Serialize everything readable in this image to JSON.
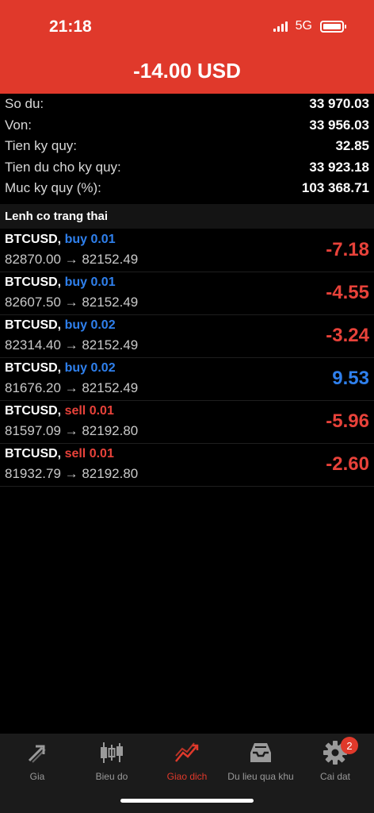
{
  "status": {
    "time": "21:18",
    "network": "5G"
  },
  "header": {
    "title": "-14.00 USD"
  },
  "summary": [
    {
      "label": "So du:",
      "value": "33 970.03"
    },
    {
      "label": "Von:",
      "value": "33 956.03"
    },
    {
      "label": "Tien ky quy:",
      "value": "32.85"
    },
    {
      "label": "Tien du cho ky quy:",
      "value": "33 923.18"
    },
    {
      "label": "Muc ky quy (%):",
      "value": "103 368.71"
    }
  ],
  "section": {
    "title": "Lenh co trang thai"
  },
  "orders": [
    {
      "symbol": "BTCUSD,",
      "side": "buy 0.01",
      "prices": "82870.00 → 82152.49",
      "profit": "-7.18"
    },
    {
      "symbol": "BTCUSD,",
      "side": "buy 0.01",
      "prices": "82607.50 → 82152.49",
      "profit": "-4.55"
    },
    {
      "symbol": "BTCUSD,",
      "side": "buy 0.02",
      "prices": "82314.40 → 82152.49",
      "profit": "-3.24"
    },
    {
      "symbol": "BTCUSD,",
      "side": "buy 0.02",
      "prices": "81676.20 → 82152.49",
      "profit": "9.53"
    },
    {
      "symbol": "BTCUSD,",
      "side": "sell 0.01",
      "prices": "81597.09 → 82192.80",
      "profit": "-5.96"
    },
    {
      "symbol": "BTCUSD,",
      "side": "sell 0.01",
      "prices": "81932.79 → 82192.80",
      "profit": "-2.60"
    }
  ],
  "tabs": [
    {
      "label": "Gia",
      "icon": "quotes-arrows-icon"
    },
    {
      "label": "Bieu do",
      "icon": "candlestick-chart-icon"
    },
    {
      "label": "Giao dich",
      "icon": "trade-chart-icon"
    },
    {
      "label": "Du lieu qua khu",
      "icon": "history-inbox-icon"
    },
    {
      "label": "Cai dat",
      "icon": "settings-gear-icon",
      "badge": "2"
    }
  ],
  "colors": {
    "header_red": "#e0392b",
    "buy_blue": "#2f80ed",
    "sell_red": "#e8423a",
    "profit_positive": "#2f80ed",
    "profit_negative": "#e8423a",
    "active_tab": "#e0392b"
  }
}
